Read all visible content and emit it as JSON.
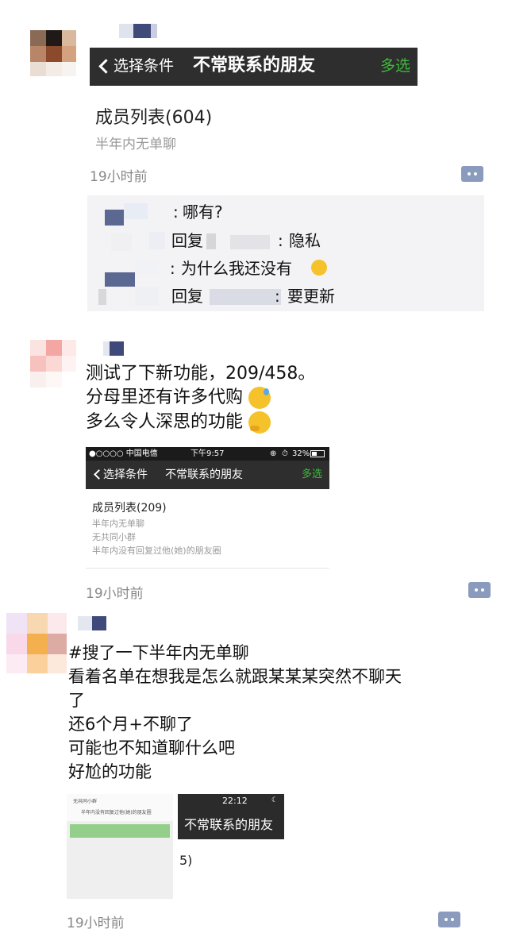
{
  "post1": {
    "screenshot": {
      "back_label": "选择条件",
      "title": "不常联系的朋友",
      "multi_select": "多选",
      "list_title": "成员列表(604)",
      "condition": "半年内无单聊"
    },
    "time": "19小时前",
    "comments": [
      {
        "sep": ":",
        "text": "哪有?"
      },
      {
        "reply": "回复",
        "sep": ":",
        "text": "隐私"
      },
      {
        "sep": ":",
        "text": "为什么我还没有"
      },
      {
        "reply": "回复",
        "sep": ":",
        "text": "要更新"
      }
    ]
  },
  "post2": {
    "lines": [
      "测试了下新功能，209/458。",
      "分母里还有许多代购",
      "多么令人深思的功能"
    ],
    "screenshot": {
      "carrier": "●○○○○ 中国电信",
      "clock": "下午9:57",
      "battery": "32%",
      "back_label": "选择条件",
      "title": "不常联系的朋友",
      "multi_select": "多选",
      "list_title": "成员列表(209)",
      "conditions": [
        "半年内无单聊",
        "无共同小群",
        "半年内没有回复过他(她)的朋友圈"
      ]
    },
    "time": "19小时前"
  },
  "post3": {
    "lines": [
      "#搜了一下半年内无单聊",
      "看着名单在想我是怎么就跟某某某突然不聊天",
      "了",
      "还6个月+不聊了",
      "可能也不知道聊什么吧",
      "好尬的功能"
    ],
    "thumb_left": {
      "row1": "无共同小群",
      "row2": "半年内没有回复过他(她)的朋友圈"
    },
    "thumb_right": {
      "clock": "22:12",
      "title": "不常联系的朋友"
    },
    "thumb_caption": "5)",
    "time": "19小时前"
  },
  "colors": {
    "navbar": "#2e2e2e",
    "green": "#3dbb3d",
    "comment_bg": "#f3f3f5",
    "time": "#888888",
    "comment_icon": "#8a9bbd"
  }
}
